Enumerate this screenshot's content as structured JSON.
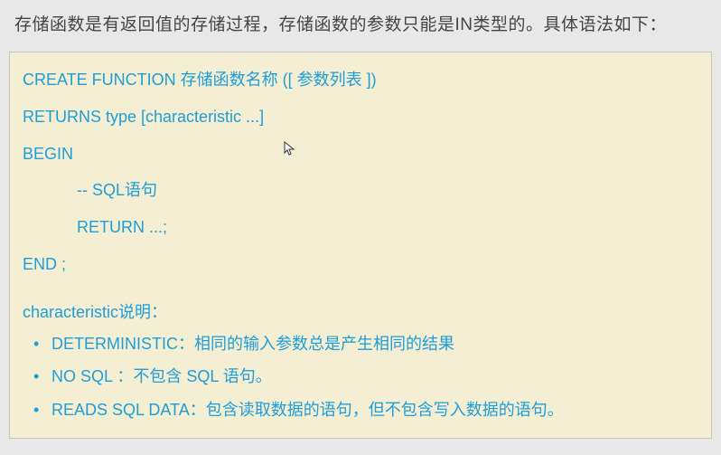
{
  "intro": "存储函数是有返回值的存储过程，存储函数的参数只能是IN类型的。具体语法如下：",
  "code": {
    "line1": "CREATE  FUNCTION   存储函数名称 ([ 参数列表 ])",
    "line2": "RETURNS  type  [characteristic ...]",
    "line3": "BEGIN",
    "line4": "-- SQL语句",
    "line5": "RETURN ...;",
    "line6": "END ;"
  },
  "heading": "characteristic说明：",
  "bullets": {
    "b1": "DETERMINISTIC：相同的输入参数总是产生相同的结果",
    "b2": "NO SQL ：不包含 SQL 语句。",
    "b3": "READS SQL DATA：包含读取数据的语句，但不包含写入数据的语句。"
  },
  "bullet_dot": "•"
}
